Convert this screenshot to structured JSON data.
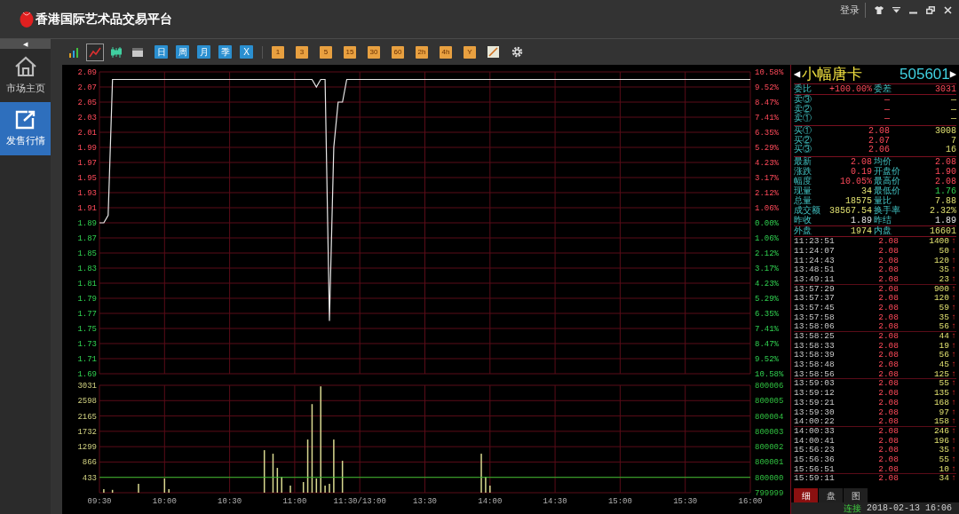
{
  "window": {
    "title": "香港国际艺术品交易平台",
    "login": "登录"
  },
  "sidebar": {
    "collapse": "◀",
    "items": [
      {
        "label": "市场主页",
        "kind": "home",
        "selected": false
      },
      {
        "label": "发售行情",
        "kind": "trade",
        "selected": true
      }
    ]
  },
  "toolbar": {
    "chart_types": [
      {
        "kind": "bars",
        "selected": false
      },
      {
        "kind": "line",
        "selected": true
      },
      {
        "kind": "candles",
        "selected": false
      },
      {
        "kind": "calendar",
        "selected": false
      }
    ],
    "period_buttons": [
      "日",
      "周",
      "月",
      "季",
      "X"
    ],
    "minute_buttons": [
      "1",
      "3",
      "5",
      "15",
      "30",
      "60",
      "2h",
      "4h",
      "Y"
    ]
  },
  "price_chart": {
    "right_labels": [
      "10.58%",
      "9.52%",
      "8.47%",
      "7.41%",
      "6.35%",
      "5.29%",
      "4.23%",
      "3.17%",
      "2.12%",
      "1.06%",
      "0.00%",
      "1.06%",
      "2.12%",
      "3.17%",
      "4.23%",
      "5.29%",
      "6.35%",
      "7.41%",
      "8.47%",
      "9.52%",
      "10.58%"
    ],
    "chart_data": {
      "type": "line",
      "grid": true,
      "ylim": [
        1.69,
        2.09
      ],
      "yticks": [
        {
          "value": 2.09,
          "label": "2.09"
        },
        {
          "value": 2.07,
          "label": "2.07"
        },
        {
          "value": 2.05,
          "label": "2.05"
        },
        {
          "value": 2.03,
          "label": "2.03"
        },
        {
          "value": 2.01,
          "label": "2.01"
        },
        {
          "value": 1.99,
          "label": "1.99"
        },
        {
          "value": 1.97,
          "label": "1.97"
        },
        {
          "value": 1.95,
          "label": "1.95"
        },
        {
          "value": 1.93,
          "label": "1.93"
        },
        {
          "value": 1.91,
          "label": "1.91"
        },
        {
          "value": 1.89,
          "label": "1.89"
        },
        {
          "value": 1.87,
          "label": "1.87"
        },
        {
          "value": 1.85,
          "label": "1.85"
        },
        {
          "value": 1.83,
          "label": "1.83"
        },
        {
          "value": 1.81,
          "label": "1.81"
        },
        {
          "value": 1.79,
          "label": "1.79"
        },
        {
          "value": 1.77,
          "label": "1.77"
        },
        {
          "value": 1.75,
          "label": "1.75"
        },
        {
          "value": 1.73,
          "label": "1.73"
        },
        {
          "value": 1.71,
          "label": "1.71"
        },
        {
          "value": 1.69,
          "label": "1.69"
        }
      ],
      "series": [
        {
          "color": "#e8e8e8",
          "values": [
            1.89,
            1.89,
            1.9,
            2.08,
            2.08,
            2.08,
            2.08,
            2.08,
            2.08,
            2.08,
            2.08,
            2.08,
            2.08,
            2.08,
            2.08,
            2.08,
            2.08,
            2.08,
            2.08,
            2.08,
            2.08,
            2.08,
            2.08,
            2.08,
            2.08,
            2.08,
            2.08,
            2.08,
            2.08,
            2.08,
            2.08,
            2.08,
            2.08,
            2.08,
            2.08,
            2.08,
            2.08,
            2.08,
            2.08,
            2.08,
            2.08,
            2.08,
            2.08,
            2.08,
            2.08,
            2.08,
            2.08,
            2.08,
            2.08,
            2.08,
            2.07,
            2.08,
            2.08,
            1.76,
            1.99,
            2.05,
            2.05,
            2.08,
            2.08,
            2.08,
            2.08,
            2.08,
            2.08,
            2.08,
            2.08,
            2.08,
            2.08,
            2.08,
            2.08,
            2.08,
            2.08,
            2.08,
            2.08,
            2.08,
            2.08,
            2.08,
            2.08,
            2.08,
            2.08,
            2.08,
            2.08,
            2.08,
            2.08,
            2.08,
            2.08,
            2.08,
            2.08,
            2.08,
            2.08,
            2.08,
            2.08,
            2.08,
            2.08,
            2.08,
            2.08,
            2.08,
            2.08,
            2.08,
            2.08,
            2.08,
            2.08,
            2.08,
            2.08,
            2.08,
            2.08,
            2.08,
            2.08,
            2.08,
            2.08,
            2.08,
            2.08,
            2.08,
            2.08,
            2.08,
            2.08,
            2.08,
            2.08,
            2.08,
            2.08,
            2.08,
            2.08,
            2.08,
            2.08,
            2.08,
            2.08,
            2.08,
            2.08,
            2.08,
            2.08,
            2.08,
            2.08,
            2.08,
            2.08,
            2.08,
            2.08,
            2.08,
            2.08,
            2.08,
            2.08,
            2.08,
            2.08,
            2.08,
            2.08,
            2.08,
            2.08,
            2.08,
            2.08,
            2.08,
            2.08,
            2.08,
            2.08
          ]
        }
      ]
    }
  },
  "volume_chart": {
    "right_labels": [
      "800006",
      "800005",
      "800004",
      "800003",
      "800002",
      "800001",
      "800000",
      "799999"
    ],
    "chart_data": {
      "type": "bar",
      "grid": true,
      "ylim": [
        0,
        3031
      ],
      "categories": [
        "09:30",
        null,
        null,
        null,
        null,
        null,
        null,
        null,
        null,
        null,
        null,
        null,
        null,
        null,
        null,
        "10:00",
        null,
        null,
        null,
        null,
        null,
        null,
        null,
        null,
        null,
        null,
        null,
        null,
        null,
        null,
        "10:30",
        null,
        null,
        null,
        null,
        null,
        null,
        null,
        null,
        null,
        null,
        null,
        null,
        null,
        null,
        "11:00",
        null,
        null,
        null,
        null,
        null,
        null,
        null,
        null,
        null,
        null,
        null,
        null,
        null,
        null,
        "11:30/13:00",
        null,
        null,
        null,
        null,
        null,
        null,
        null,
        null,
        null,
        null,
        null,
        null,
        null,
        null,
        "13:30",
        null,
        null,
        null,
        null,
        null,
        null,
        null,
        null,
        null,
        null,
        null,
        null,
        null,
        null,
        "14:00",
        null,
        null,
        null,
        null,
        null,
        null,
        null,
        null,
        null,
        null,
        null,
        null,
        null,
        null,
        "14:30",
        null,
        null,
        null,
        null,
        null,
        null,
        null,
        null,
        null,
        null,
        null,
        null,
        null,
        null,
        "15:00",
        null,
        null,
        null,
        null,
        null,
        null,
        null,
        null,
        null,
        null,
        null,
        null,
        null,
        null,
        "15:30",
        null,
        null,
        null,
        null,
        null,
        null,
        null,
        null,
        null,
        null,
        null,
        null,
        null,
        null,
        "16:00"
      ],
      "yticks": [
        {
          "value": 3031,
          "label": "3031"
        },
        {
          "value": 2598,
          "label": "2598"
        },
        {
          "value": 2165,
          "label": "2165"
        },
        {
          "value": 1732,
          "label": "1732"
        },
        {
          "value": 1299,
          "label": "1299"
        },
        {
          "value": 866,
          "label": "866"
        },
        {
          "value": 433,
          "label": "433"
        }
      ],
      "series": [
        {
          "color": "#d8d890",
          "values": [
            0,
            100,
            0,
            80,
            0,
            0,
            0,
            0,
            0,
            250,
            0,
            0,
            0,
            0,
            0,
            400,
            100,
            0,
            0,
            0,
            0,
            0,
            0,
            0,
            0,
            0,
            0,
            0,
            0,
            0,
            0,
            0,
            0,
            0,
            0,
            0,
            0,
            0,
            1200,
            0,
            1100,
            700,
            450,
            0,
            200,
            0,
            0,
            300,
            1500,
            2500,
            400,
            3000,
            200,
            250,
            1500,
            0,
            900,
            0,
            0,
            0,
            0,
            0,
            0,
            0,
            0,
            0,
            0,
            0,
            0,
            0,
            0,
            0,
            0,
            0,
            0,
            0,
            0,
            0,
            0,
            0,
            0,
            0,
            0,
            0,
            0,
            0,
            0,
            0,
            1100,
            450,
            200,
            0,
            0,
            0,
            0,
            0,
            0,
            0,
            0,
            0,
            0,
            0,
            0,
            0,
            0,
            0,
            0,
            0,
            0,
            0,
            0,
            0,
            0,
            0,
            0,
            0,
            0,
            0,
            0,
            0,
            0,
            0,
            0,
            0,
            0,
            0,
            0,
            0,
            0,
            0,
            0,
            0,
            0,
            0,
            0,
            0,
            0,
            0,
            0,
            0,
            0,
            0,
            0,
            0,
            0,
            0,
            0,
            0,
            0,
            0,
            0
          ]
        }
      ],
      "ref_lines": [
        {
          "axis": "y",
          "value": 433
        }
      ]
    }
  },
  "quote": {
    "prev_arrow": "◀",
    "name": "小幅唐卡",
    "code": "505601",
    "next_arrow": "▶",
    "ratio": {
      "label": "委比",
      "value": "+100.00%",
      "label2": "委差",
      "value2": "3031"
    },
    "sells": [
      {
        "label": "卖③",
        "price": "—",
        "volume": "—"
      },
      {
        "label": "卖②",
        "price": "—",
        "volume": "—"
      },
      {
        "label": "卖①",
        "price": "—",
        "volume": "—"
      }
    ],
    "buys": [
      {
        "label": "买①",
        "price": "2.08",
        "volume": "3008"
      },
      {
        "label": "买②",
        "price": "2.07",
        "volume": "7"
      },
      {
        "label": "买③",
        "price": "2.06",
        "volume": "16"
      }
    ],
    "stats": [
      {
        "cells": [
          {
            "label": "最新",
            "value": "2.08",
            "kind": "up"
          },
          {
            "label": "均价",
            "value": "2.08",
            "kind": "up"
          }
        ]
      },
      {
        "cells": [
          {
            "label": "涨跌",
            "value": "0.19",
            "kind": "up"
          },
          {
            "label": "开盘价",
            "value": "1.90",
            "kind": "up"
          }
        ]
      },
      {
        "cells": [
          {
            "label": "幅度",
            "value": "10.05%",
            "kind": "up"
          },
          {
            "label": "最高价",
            "value": "2.08",
            "kind": "up"
          }
        ]
      },
      {
        "cells": [
          {
            "label": "现量",
            "value": "34",
            "kind": "volume"
          },
          {
            "label": "最低价",
            "value": "1.76",
            "kind": "down"
          }
        ]
      },
      {
        "cells": [
          {
            "label": "总量",
            "value": "18575",
            "kind": "volume"
          },
          {
            "label": "量比",
            "value": "7.88",
            "kind": "volume"
          }
        ]
      },
      {
        "cells": [
          {
            "label": "成交额",
            "value": "38567.54",
            "kind": "volume"
          },
          {
            "label": "换手率",
            "value": "2.32%",
            "kind": "volume"
          }
        ]
      },
      {
        "cells": [
          {
            "label": "昨收",
            "value": "1.89",
            "kind": "flat"
          },
          {
            "label": "昨结",
            "value": "1.89",
            "kind": "flat"
          }
        ]
      }
    ],
    "outer": {
      "label": "外盘",
      "value": "1974",
      "label2": "内盘",
      "value2": "16601"
    },
    "trades": [
      {
        "time": "11:23:51",
        "price": "2.08",
        "volume": "1400",
        "arrow": "↑"
      },
      {
        "time": "11:24:07",
        "price": "2.08",
        "volume": "50",
        "arrow": "↑"
      },
      {
        "time": "11:24:43",
        "price": "2.08",
        "volume": "120",
        "arrow": "↑"
      },
      {
        "time": "13:48:51",
        "price": "2.08",
        "volume": "35",
        "arrow": "↑"
      },
      {
        "time": "13:49:11",
        "price": "2.08",
        "volume": "23",
        "arrow": "↑"
      },
      {
        "time": "13:57:29",
        "price": "2.08",
        "volume": "900",
        "arrow": "↑"
      },
      {
        "time": "13:57:37",
        "price": "2.08",
        "volume": "120",
        "arrow": "↑"
      },
      {
        "time": "13:57:45",
        "price": "2.08",
        "volume": "59",
        "arrow": "↑"
      },
      {
        "time": "13:57:58",
        "price": "2.08",
        "volume": "35",
        "arrow": "↑"
      },
      {
        "time": "13:58:06",
        "price": "2.08",
        "volume": "56",
        "arrow": "↑"
      },
      {
        "time": "13:58:25",
        "price": "2.08",
        "volume": "44",
        "arrow": "↑"
      },
      {
        "time": "13:58:33",
        "price": "2.08",
        "volume": "19",
        "arrow": "↑"
      },
      {
        "time": "13:58:39",
        "price": "2.08",
        "volume": "56",
        "arrow": "↑"
      },
      {
        "time": "13:58:48",
        "price": "2.08",
        "volume": "45",
        "arrow": "↑"
      },
      {
        "time": "13:58:56",
        "price": "2.08",
        "volume": "125",
        "arrow": "↑"
      },
      {
        "time": "13:59:03",
        "price": "2.08",
        "volume": "55",
        "arrow": "↑"
      },
      {
        "time": "13:59:12",
        "price": "2.08",
        "volume": "135",
        "arrow": "↑"
      },
      {
        "time": "13:59:21",
        "price": "2.08",
        "volume": "168",
        "arrow": "↑"
      },
      {
        "time": "13:59:30",
        "price": "2.08",
        "volume": "97",
        "arrow": "↑"
      },
      {
        "time": "14:00:22",
        "price": "2.08",
        "volume": "158",
        "arrow": "↑"
      },
      {
        "time": "14:00:33",
        "price": "2.08",
        "volume": "246",
        "arrow": "↑"
      },
      {
        "time": "14:00:41",
        "price": "2.08",
        "volume": "196",
        "arrow": "↑"
      },
      {
        "time": "15:56:23",
        "price": "2.08",
        "volume": "35",
        "arrow": "↑"
      },
      {
        "time": "15:56:36",
        "price": "2.08",
        "volume": "55",
        "arrow": "↑"
      },
      {
        "time": "15:56:51",
        "price": "2.08",
        "volume": "10",
        "arrow": "↑"
      },
      {
        "time": "15:59:11",
        "price": "2.08",
        "volume": "34",
        "arrow": "↑"
      }
    ],
    "tabs": [
      {
        "label": "细",
        "selected": true
      },
      {
        "label": "盘",
        "selected": false
      },
      {
        "label": "图",
        "selected": false
      }
    ]
  },
  "status_bar": {
    "connection": "连接",
    "datetime": "2018-02-13 16:06"
  }
}
